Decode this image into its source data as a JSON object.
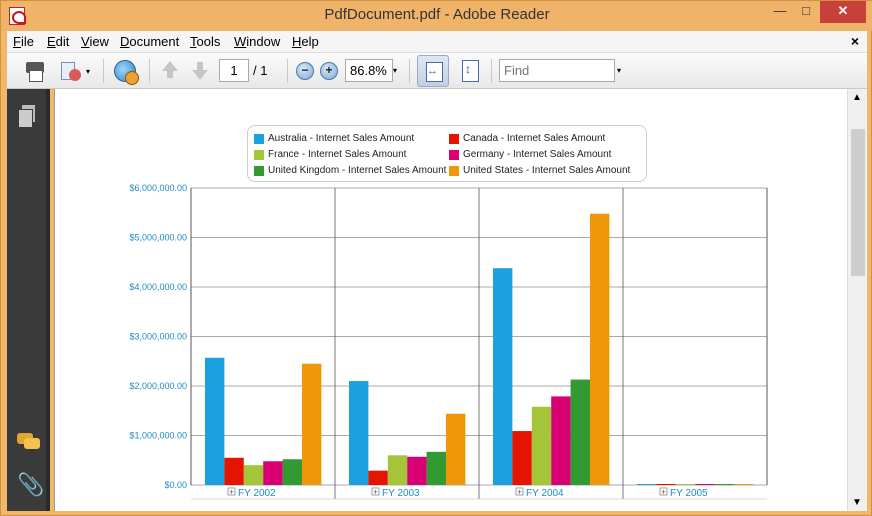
{
  "window": {
    "title": "PdfDocument.pdf - Adobe Reader",
    "controls": {
      "minimize": "—",
      "maximize": "□",
      "close": "✕"
    }
  },
  "menu": {
    "items": [
      {
        "label": "File",
        "accel": "F",
        "rest": "ile"
      },
      {
        "label": "Edit",
        "accel": "E",
        "rest": "dit"
      },
      {
        "label": "View",
        "accel": "V",
        "rest": "iew"
      },
      {
        "label": "Document",
        "accel": "D",
        "rest": "ocument"
      },
      {
        "label": "Tools",
        "accel": "T",
        "rest": "ools"
      },
      {
        "label": "Window",
        "accel": "W",
        "rest": "indow"
      },
      {
        "label": "Help",
        "accel": "H",
        "rest": "elp"
      }
    ],
    "doc_close": "×"
  },
  "toolbar": {
    "page_current": "1",
    "page_total": "/ 1",
    "zoom_out": "−",
    "zoom_in": "+",
    "zoom_value": "86.8%",
    "find_placeholder": "Find",
    "dropdown_arrow": "▾"
  },
  "icons": {
    "print": "printer-icon",
    "share": "share-icon",
    "collaborate": "globe-icon",
    "prev_page": "arrow-up-icon",
    "next_page": "arrow-down-icon",
    "fit_width": "fit-width-icon",
    "fit_page": "fit-page-icon",
    "pages": "pages-icon",
    "comments": "comment-icon",
    "attachments": "paperclip-icon"
  },
  "chart_data": {
    "type": "bar",
    "categories": [
      "FY 2002",
      "FY 2003",
      "FY 2004",
      "FY 2005"
    ],
    "category_expander": "+",
    "series": [
      {
        "name": "Australia - Internet Sales Amount",
        "color": "#1ba1e2",
        "values": [
          2570000,
          2100000,
          4380000,
          0
        ]
      },
      {
        "name": "Canada - Internet Sales Amount",
        "color": "#e51400",
        "values": [
          550000,
          290000,
          1090000,
          0
        ]
      },
      {
        "name": "France - Internet Sales Amount",
        "color": "#a4c439",
        "values": [
          400000,
          600000,
          1580000,
          0
        ]
      },
      {
        "name": "Germany - Internet Sales Amount",
        "color": "#d80073",
        "values": [
          480000,
          570000,
          1790000,
          0
        ]
      },
      {
        "name": "United Kingdom - Internet Sales Amount",
        "color": "#339933",
        "values": [
          520000,
          670000,
          2130000,
          0
        ]
      },
      {
        "name": "United States - Internet Sales Amount",
        "color": "#f09609",
        "values": [
          2450000,
          1440000,
          5480000,
          0
        ]
      }
    ],
    "y_ticks": [
      "$0.00",
      "$1,000,000.00",
      "$2,000,000.00",
      "$3,000,000.00",
      "$4,000,000.00",
      "$5,000,000.00",
      "$6,000,000.00"
    ],
    "ylim": [
      0,
      6000000
    ],
    "grid": true,
    "legend_position": "top"
  }
}
